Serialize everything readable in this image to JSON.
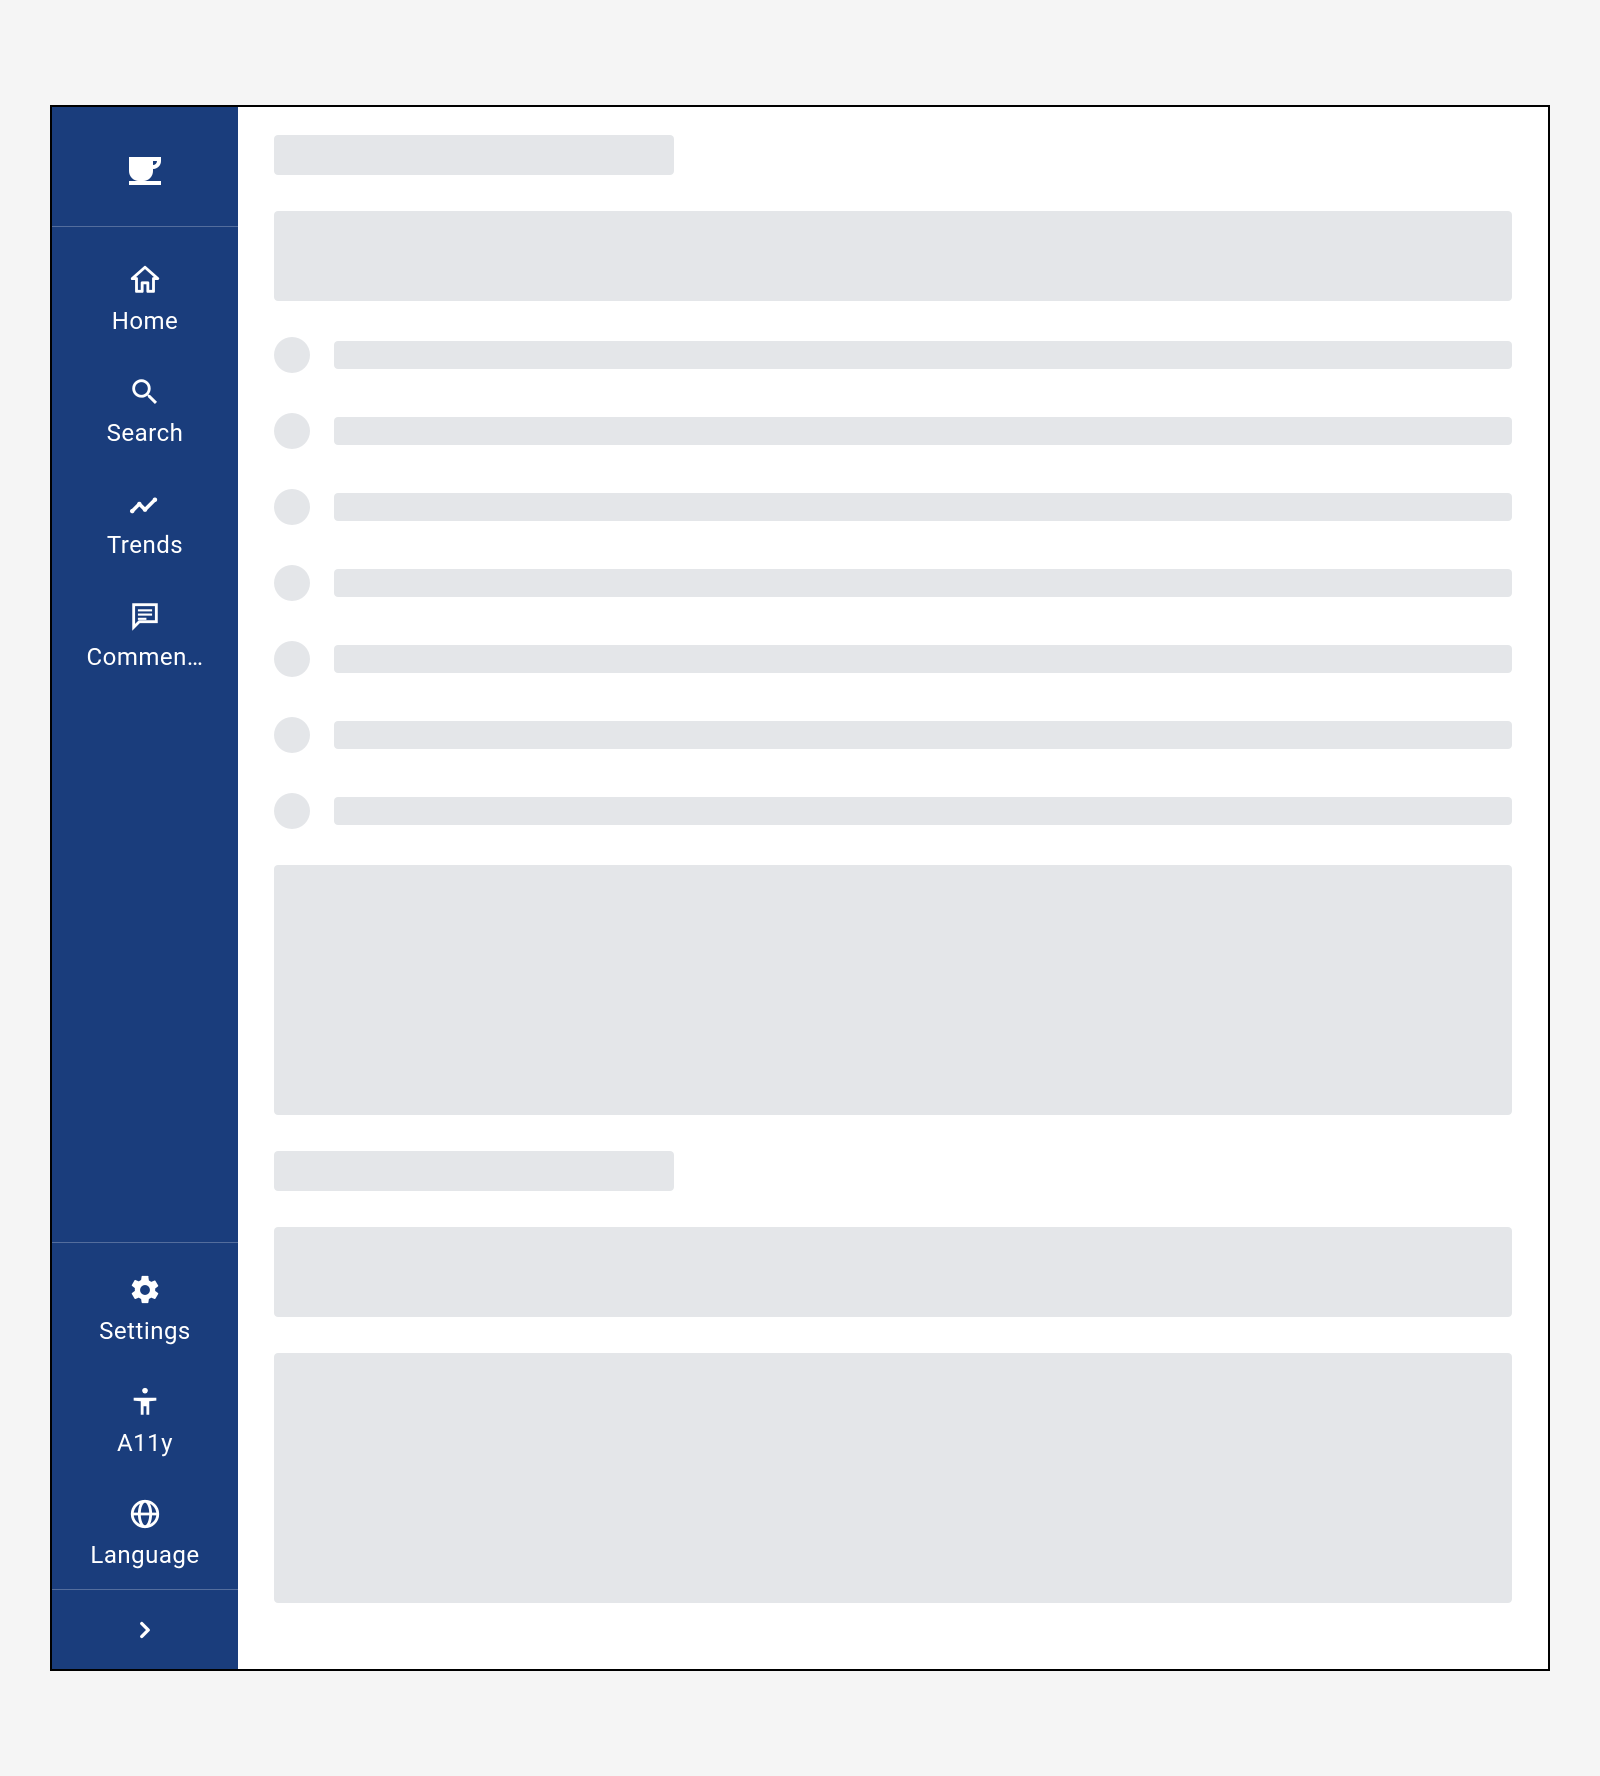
{
  "sidebar": {
    "logo": "coffee-logo",
    "nav": [
      {
        "icon": "home-icon",
        "label": "Home"
      },
      {
        "icon": "search-icon",
        "label": "Search"
      },
      {
        "icon": "trends-icon",
        "label": "Trends"
      },
      {
        "icon": "comments-icon",
        "label": "Commen…"
      }
    ],
    "footer": [
      {
        "icon": "settings-icon",
        "label": "Settings"
      },
      {
        "icon": "accessibility-icon",
        "label": "A11y"
      },
      {
        "icon": "language-icon",
        "label": "Language"
      }
    ],
    "expand_icon": "chevron-right-icon"
  },
  "main": {
    "skeleton_list_items": 7
  },
  "colors": {
    "sidebar_bg": "#1a3d7c",
    "skeleton": "#e4e6e9"
  }
}
